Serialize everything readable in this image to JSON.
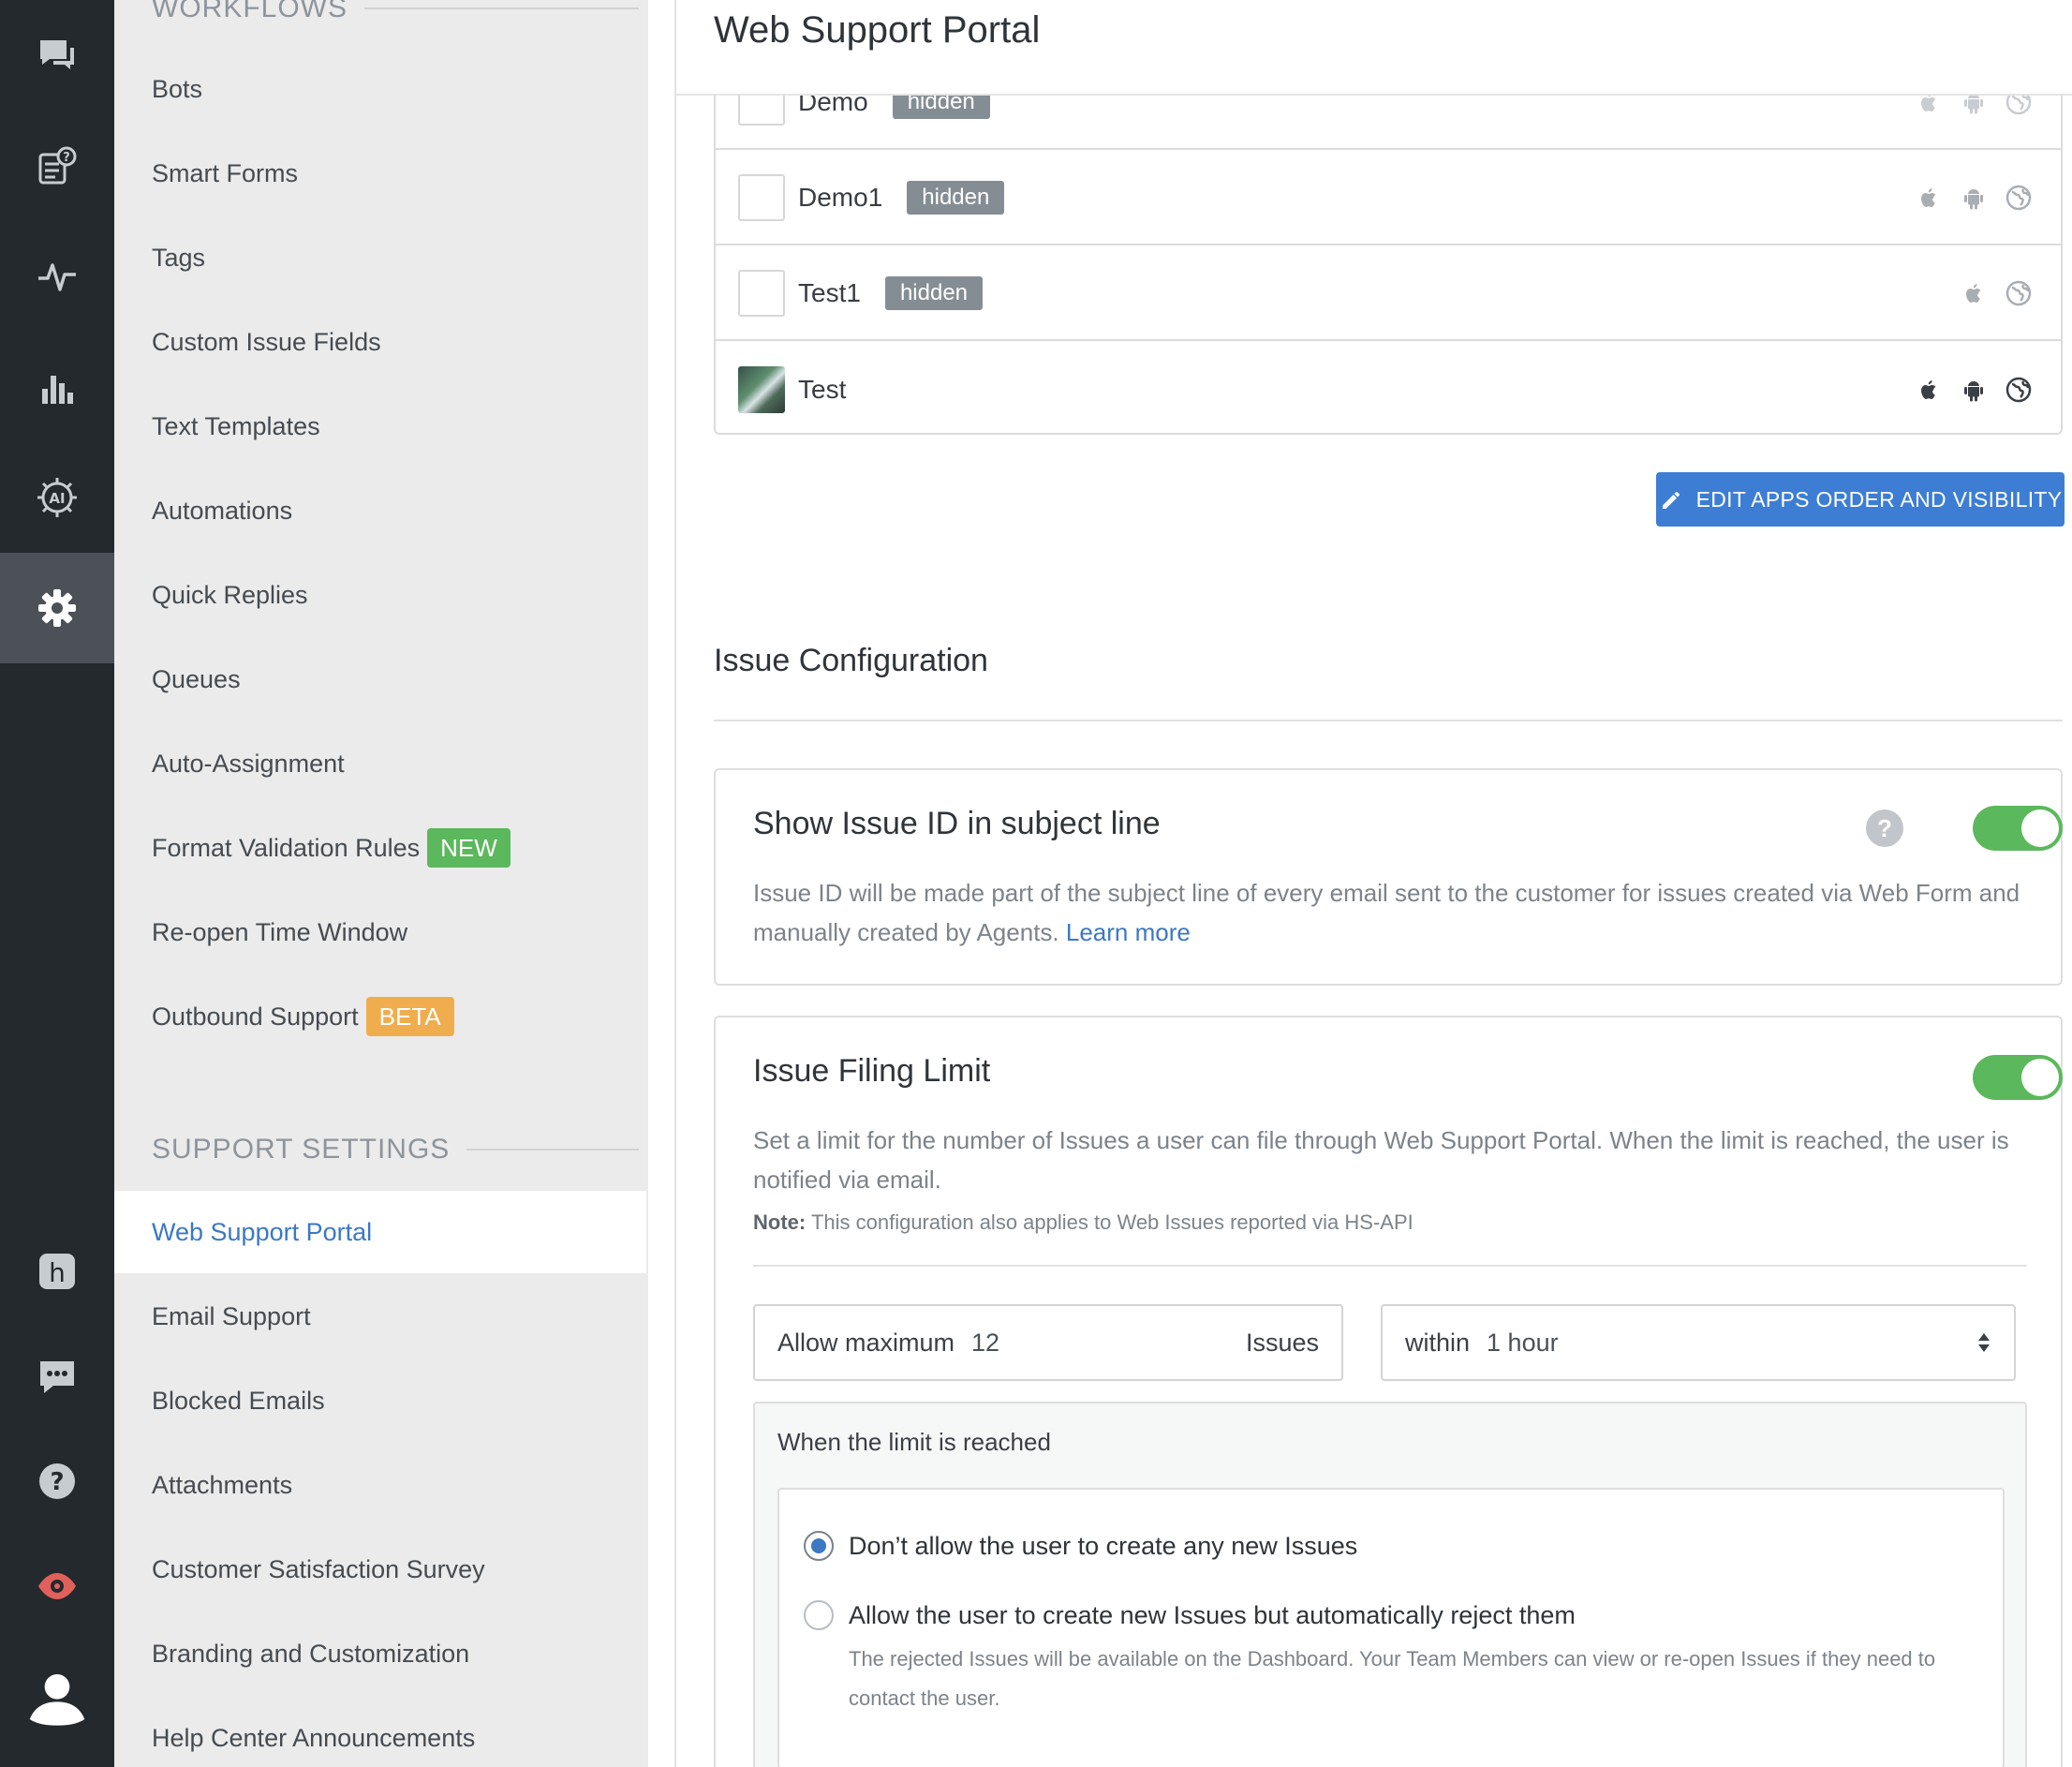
{
  "rail": {
    "icons": [
      "chat-bubbles-icon",
      "faq-article-icon",
      "activity-pulse-icon",
      "bar-chart-icon",
      "ai-brain-icon",
      "gear-icon",
      "h-logo-icon",
      "message-dots-icon",
      "help-circle-icon",
      "eye-icon",
      "user-avatar-icon"
    ]
  },
  "sidebar": {
    "workflows_heading": "WORKFLOWS",
    "workflows": [
      {
        "label": "Bots"
      },
      {
        "label": "Smart Forms"
      },
      {
        "label": "Tags"
      },
      {
        "label": "Custom Issue Fields"
      },
      {
        "label": "Text Templates"
      },
      {
        "label": "Automations"
      },
      {
        "label": "Quick Replies"
      },
      {
        "label": "Queues"
      },
      {
        "label": "Auto-Assignment"
      },
      {
        "label": "Format Validation Rules",
        "badge": "NEW"
      },
      {
        "label": "Re-open Time Window"
      },
      {
        "label": "Outbound Support",
        "badge": "BETA"
      }
    ],
    "support_heading": "SUPPORT SETTINGS",
    "support": [
      {
        "label": "Web Support Portal",
        "active": true
      },
      {
        "label": "Email Support"
      },
      {
        "label": "Blocked Emails"
      },
      {
        "label": "Attachments"
      },
      {
        "label": "Customer Satisfaction Survey"
      },
      {
        "label": "Branding and Customization"
      },
      {
        "label": "Help Center Announcements"
      }
    ]
  },
  "header": {
    "title": "Web Support Portal"
  },
  "apps": [
    {
      "name": "Demo",
      "badge": "hidden",
      "platforms": [
        "apple",
        "android",
        "web"
      ]
    },
    {
      "name": "Demo1",
      "badge": "hidden",
      "platforms": [
        "apple",
        "android",
        "web"
      ]
    },
    {
      "name": "Test1",
      "badge": "hidden",
      "platforms": [
        "apple",
        "web"
      ]
    },
    {
      "name": "Test",
      "badge": "",
      "platforms": [
        "apple",
        "android",
        "web"
      ],
      "has_thumb": true
    }
  ],
  "edit_button": "EDIT APPS ORDER AND VISIBILITY",
  "issue_config": {
    "title": "Issue Configuration",
    "show_id": {
      "title": "Show Issue ID in subject line",
      "desc": "Issue ID will be made part of the subject line of every email sent to the customer for issues created via Web Form and manually created by Agents.",
      "link": "Learn more",
      "help": "?",
      "enabled": true
    },
    "filing_limit": {
      "title": "Issue Filing Limit",
      "desc": "Set a limit for the number of Issues a user can file through Web Support Portal. When the limit is reached, the user is notified via email.",
      "note_label": "Note:",
      "note_text": "This configuration also applies to Web Issues reported via HS-API",
      "enabled": true,
      "allow_label": "Allow maximum",
      "allow_value": "12",
      "allow_suffix": "Issues",
      "within_label": "within",
      "within_value": "1 hour",
      "when_heading": "When the limit is reached",
      "option1": "Don’t allow the user to create any new Issues",
      "option2": "Allow the user to create new Issues but automatically reject them",
      "option2_desc": "The rejected Issues will be available on the Dashboard. Your Team Members can view or re-open Issues if they need to contact the user.",
      "selected": 1
    }
  },
  "colors": {
    "accent": "#3c78c4",
    "toggle_on": "#5cb85c",
    "badge_new": "#5cb85c",
    "badge_beta": "#f0ad4e",
    "rail": "#24292e"
  }
}
